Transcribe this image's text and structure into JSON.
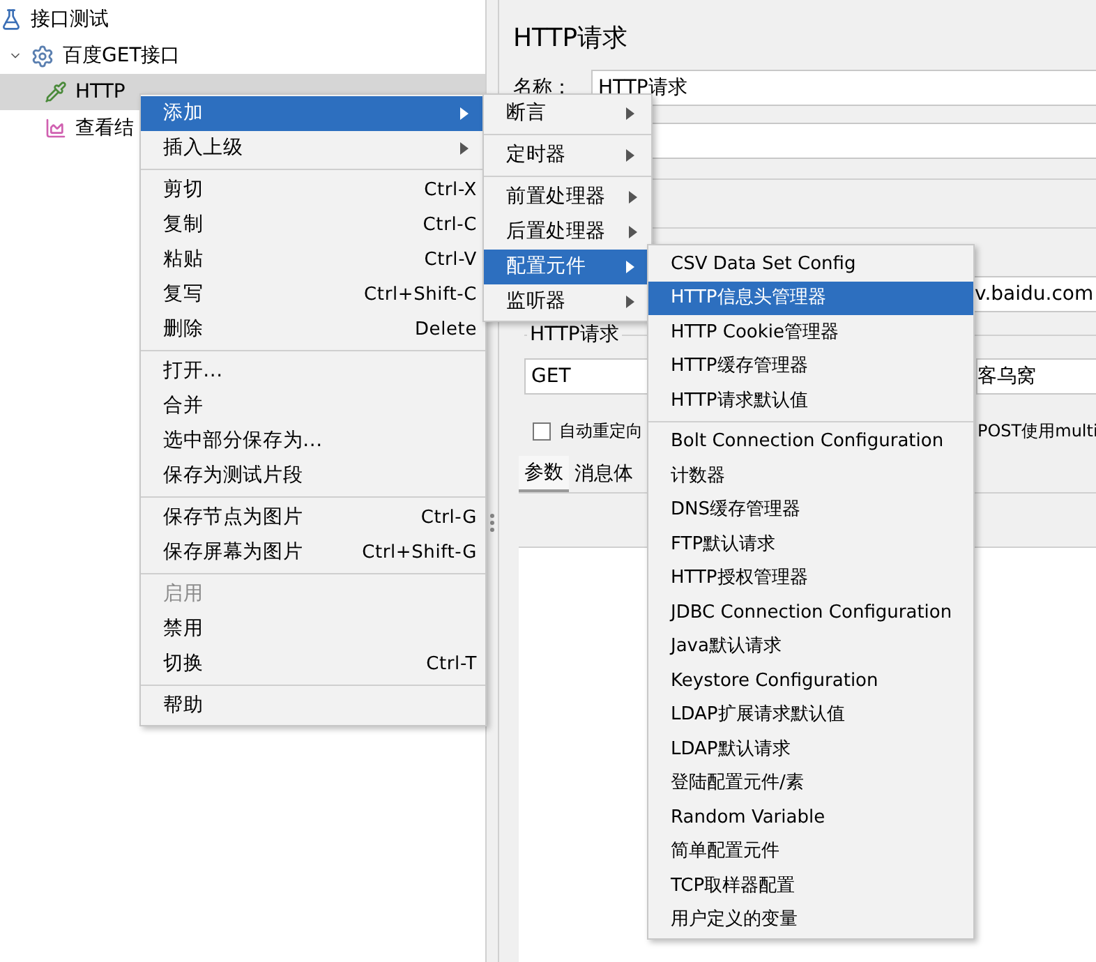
{
  "tree": [
    {
      "label": "接口测试",
      "kind": "test_plan",
      "selected": false,
      "children": [
        {
          "label": "百度GET接口",
          "kind": "thread_group",
          "selected": false,
          "expanded": true,
          "children": [
            {
              "label": "HTTP",
              "kind": "sampler",
              "selected": true
            },
            {
              "label": "查看结",
              "kind": "listener",
              "selected": false
            }
          ]
        }
      ]
    }
  ],
  "editor": {
    "title": "HTTP请求",
    "name_label": "名称：",
    "name_value": "HTTP请求",
    "server_value": "v.baidu.com",
    "group_label": "HTTP请求",
    "method": "GET",
    "path_value": "客乌窝",
    "redirect": {
      "label": "自动重定向",
      "checked": false
    },
    "multipart_label": "POST使用multi",
    "tabs": [
      {
        "label": "参数",
        "selected": true
      },
      {
        "label": "消息体",
        "selected": false
      }
    ]
  },
  "context_menu": [
    {
      "kind": "item",
      "label": "添加",
      "submenu": true,
      "selected": true
    },
    {
      "kind": "item",
      "label": "插入上级",
      "submenu": true,
      "selected": false
    },
    {
      "kind": "separator"
    },
    {
      "kind": "item",
      "label": "剪切",
      "shortcut": "Ctrl-X",
      "selected": false
    },
    {
      "kind": "item",
      "label": "复制",
      "shortcut": "Ctrl-C",
      "selected": false
    },
    {
      "kind": "item",
      "label": "粘贴",
      "shortcut": "Ctrl-V",
      "selected": false
    },
    {
      "kind": "item",
      "label": "复写",
      "shortcut": "Ctrl+Shift-C",
      "selected": false
    },
    {
      "kind": "item",
      "label": "删除",
      "shortcut": "Delete",
      "selected": false
    },
    {
      "kind": "separator"
    },
    {
      "kind": "item",
      "label": "打开...",
      "selected": false
    },
    {
      "kind": "item",
      "label": "合并",
      "selected": false
    },
    {
      "kind": "item",
      "label": "选中部分保存为...",
      "selected": false
    },
    {
      "kind": "item",
      "label": "保存为测试片段",
      "selected": false
    },
    {
      "kind": "separator"
    },
    {
      "kind": "item",
      "label": "保存节点为图片",
      "shortcut": "Ctrl-G",
      "selected": false
    },
    {
      "kind": "item",
      "label": "保存屏幕为图片",
      "shortcut": "Ctrl+Shift-G",
      "selected": false
    },
    {
      "kind": "separator"
    },
    {
      "kind": "item",
      "label": "启用",
      "selected": false,
      "disabled": true
    },
    {
      "kind": "item",
      "label": "禁用",
      "selected": false
    },
    {
      "kind": "item",
      "label": "切换",
      "shortcut": "Ctrl-T",
      "selected": false
    },
    {
      "kind": "separator"
    },
    {
      "kind": "item",
      "label": "帮助",
      "selected": false
    }
  ],
  "add_submenu": [
    {
      "kind": "item",
      "label": "断言",
      "submenu": true,
      "selected": false
    },
    {
      "kind": "separator"
    },
    {
      "kind": "item",
      "label": "定时器",
      "submenu": true,
      "selected": false
    },
    {
      "kind": "separator"
    },
    {
      "kind": "item",
      "label": "前置处理器",
      "submenu": true,
      "selected": false
    },
    {
      "kind": "item",
      "label": "后置处理器",
      "submenu": true,
      "selected": false
    },
    {
      "kind": "item",
      "label": "配置元件",
      "submenu": true,
      "selected": true
    },
    {
      "kind": "item",
      "label": "监听器",
      "submenu": true,
      "selected": false
    }
  ],
  "config_submenu": [
    {
      "kind": "item",
      "label": "CSV Data Set Config",
      "selected": false
    },
    {
      "kind": "item",
      "label": "HTTP信息头管理器",
      "selected": true
    },
    {
      "kind": "item",
      "label": "HTTP Cookie管理器",
      "selected": false
    },
    {
      "kind": "item",
      "label": "HTTP缓存管理器",
      "selected": false
    },
    {
      "kind": "item",
      "label": "HTTP请求默认值",
      "selected": false
    },
    {
      "kind": "separator"
    },
    {
      "kind": "item",
      "label": "Bolt Connection Configuration",
      "selected": false
    },
    {
      "kind": "item",
      "label": "计数器",
      "selected": false
    },
    {
      "kind": "item",
      "label": "DNS缓存管理器",
      "selected": false
    },
    {
      "kind": "item",
      "label": "FTP默认请求",
      "selected": false
    },
    {
      "kind": "item",
      "label": "HTTP授权管理器",
      "selected": false
    },
    {
      "kind": "item",
      "label": "JDBC Connection Configuration",
      "selected": false
    },
    {
      "kind": "item",
      "label": "Java默认请求",
      "selected": false
    },
    {
      "kind": "item",
      "label": "Keystore Configuration",
      "selected": false
    },
    {
      "kind": "item",
      "label": "LDAP扩展请求默认值",
      "selected": false
    },
    {
      "kind": "item",
      "label": "LDAP默认请求",
      "selected": false
    },
    {
      "kind": "item",
      "label": "登陆配置元件/素",
      "selected": false
    },
    {
      "kind": "item",
      "label": "Random Variable",
      "selected": false
    },
    {
      "kind": "item",
      "label": "简单配置元件",
      "selected": false
    },
    {
      "kind": "item",
      "label": "TCP取样器配置",
      "selected": false
    },
    {
      "kind": "item",
      "label": "用户定义的变量",
      "selected": false
    }
  ]
}
